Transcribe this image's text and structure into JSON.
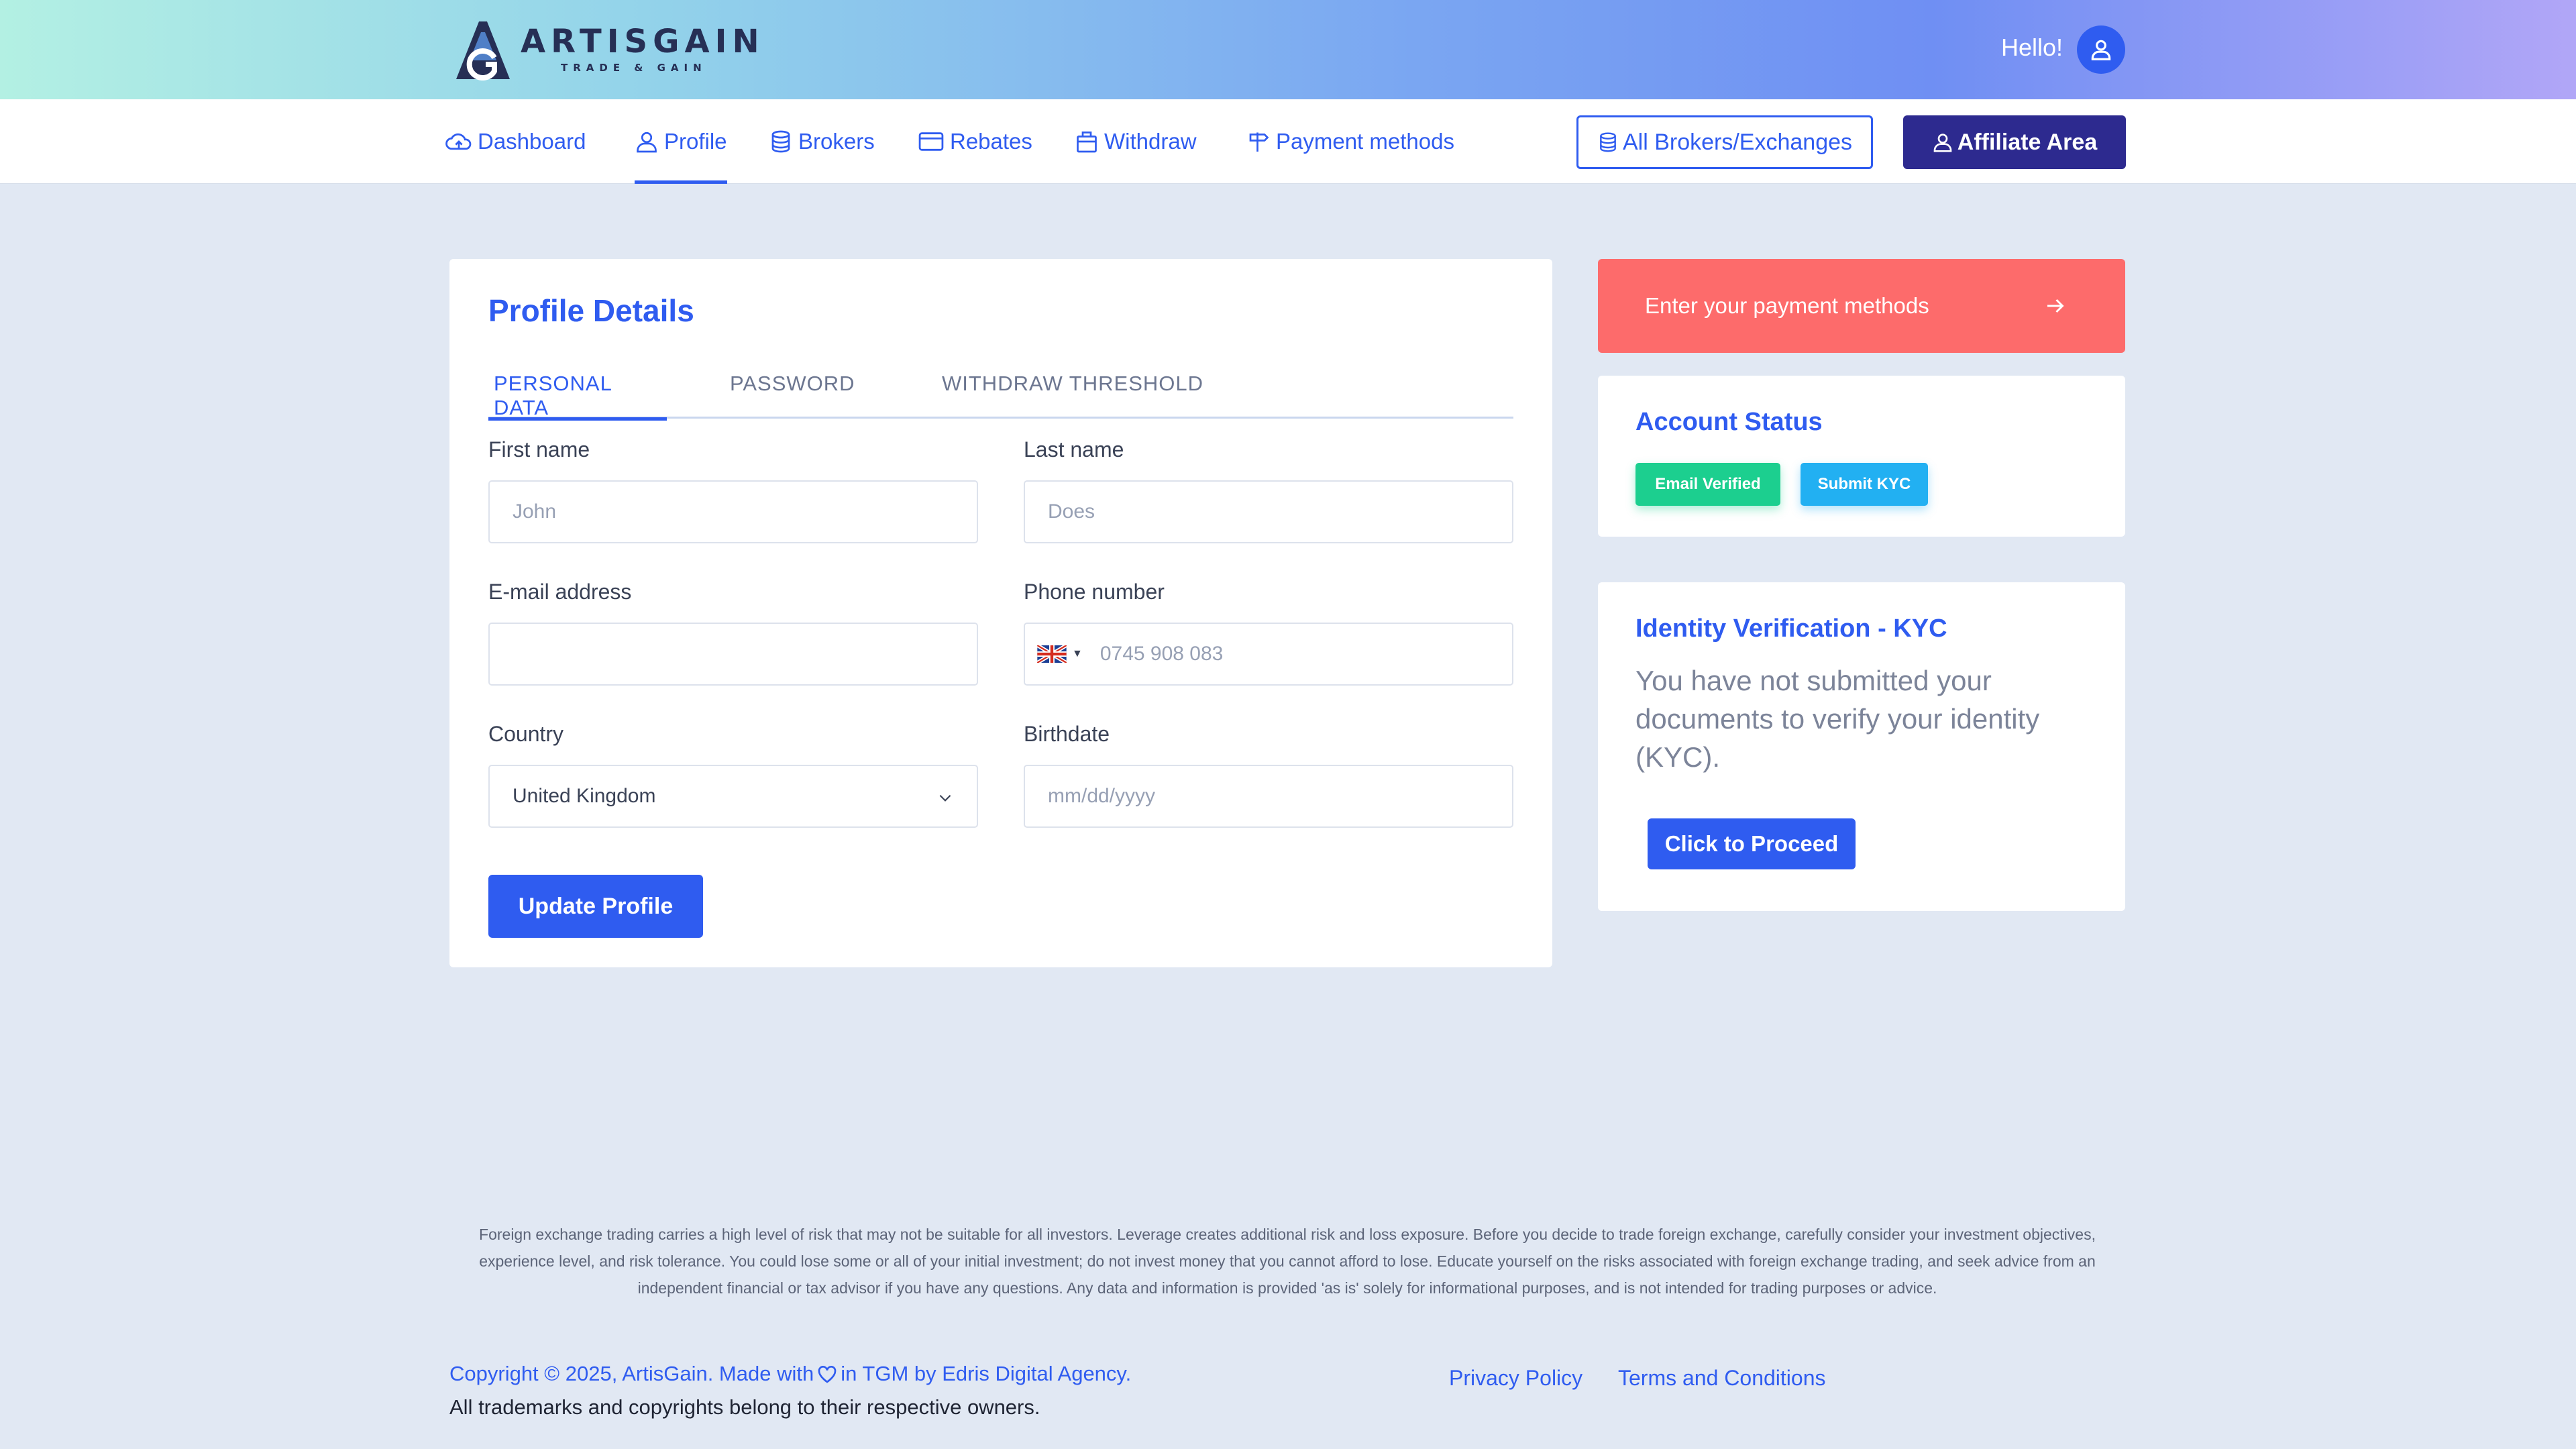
{
  "brand": {
    "name": "ARTISGAIN",
    "tagline": "TRADE & GAIN",
    "logo_icon": "g-mountain-logo"
  },
  "header": {
    "greeting": "Hello!",
    "avatar_icon": "user-icon"
  },
  "nav": {
    "items": [
      {
        "label": "Dashboard",
        "icon": "cloud-icon"
      },
      {
        "label": "Profile",
        "icon": "user-icon",
        "active": true
      },
      {
        "label": "Brokers",
        "icon": "database-icon"
      },
      {
        "label": "Rebates",
        "icon": "credit-card-icon"
      },
      {
        "label": "Withdraw",
        "icon": "briefcase-icon"
      },
      {
        "label": "Payment methods",
        "icon": "signpost-icon"
      }
    ],
    "all_brokers_label": "All Brokers/Exchanges",
    "affiliate_label": "Affiliate Area"
  },
  "profile": {
    "title": "Profile Details",
    "tabs": [
      {
        "label": "PERSONAL DATA",
        "active": true
      },
      {
        "label": "PASSWORD"
      },
      {
        "label": "WITHDRAW THRESHOLD"
      }
    ],
    "fields": {
      "first_name": {
        "label": "First name",
        "placeholder": "John"
      },
      "last_name": {
        "label": "Last name",
        "placeholder": "Does"
      },
      "email": {
        "label": "E-mail address",
        "placeholder": ""
      },
      "phone": {
        "label": "Phone number",
        "placeholder": "0745 908 083",
        "flag": "uk-flag"
      },
      "country": {
        "label": "Country",
        "value": "United Kingdom"
      },
      "birthdate": {
        "label": "Birthdate",
        "placeholder": "mm/dd/yyyy"
      }
    },
    "submit_label": "Update Profile"
  },
  "payment_banner": {
    "label": "Enter your payment methods",
    "icon": "arrow-right-icon"
  },
  "account_status": {
    "title": "Account Status",
    "badges": [
      {
        "label": "Email Verified",
        "color": "#1ccf8f"
      },
      {
        "label": "Submit KYC",
        "color": "#22b0f2"
      }
    ]
  },
  "kyc": {
    "title": "Identity Verification - KYC",
    "message": "You have not submitted your documents to verify your identity (KYC).",
    "button_label": "Click to Proceed"
  },
  "footer": {
    "disclaimer": "Foreign exchange trading carries a high level of risk that may not be suitable for all investors. Leverage creates additional risk and loss exposure. Before you decide to trade foreign exchange, carefully consider your investment objectives, experience level, and risk tolerance. You could lose some or all of your initial investment; do not invest money that you cannot afford to lose. Educate yourself on the risks associated with foreign exchange trading, and seek advice from an independent financial or tax advisor if you have any questions. Any data and information is provided 'as is' solely for informational purposes, and is not intended for trading purposes or advice.",
    "copyright_before": "Copyright © 2025, ArtisGain. Made with",
    "copyright_after": "in TGM by Edris Digital Agency.",
    "trademark": "All trademarks and copyrights belong to their respective owners.",
    "links": [
      "Privacy Policy",
      "Terms and Conditions"
    ]
  },
  "colors": {
    "accent": "#2f5cf0",
    "affiliate": "#2d2a8f",
    "payment_banner": "#fd6b6b",
    "page_background": "#e1e8f3"
  }
}
